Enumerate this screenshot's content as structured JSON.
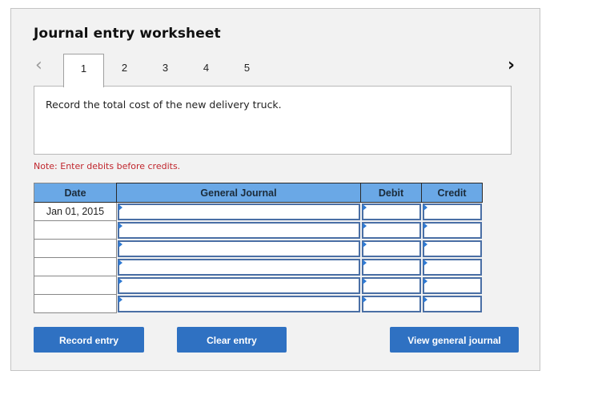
{
  "worksheet": {
    "title": "Journal entry worksheet",
    "nav": {
      "prev_icon": "chevron-left-icon",
      "next_icon": "chevron-right-icon"
    },
    "tabs": [
      {
        "label": "1",
        "active": true
      },
      {
        "label": "2",
        "active": false
      },
      {
        "label": "3",
        "active": false
      },
      {
        "label": "4",
        "active": false
      },
      {
        "label": "5",
        "active": false
      }
    ],
    "description": "Record the total cost of the new delivery truck.",
    "note": "Note: Enter debits before credits."
  },
  "journal": {
    "headers": {
      "date": "Date",
      "general_journal": "General Journal",
      "debit": "Debit",
      "credit": "Credit"
    },
    "rows": [
      {
        "date": "Jan 01, 2015",
        "account": "",
        "debit": "",
        "credit": ""
      },
      {
        "date": "",
        "account": "",
        "debit": "",
        "credit": ""
      },
      {
        "date": "",
        "account": "",
        "debit": "",
        "credit": ""
      },
      {
        "date": "",
        "account": "",
        "debit": "",
        "credit": ""
      },
      {
        "date": "",
        "account": "",
        "debit": "",
        "credit": ""
      },
      {
        "date": "",
        "account": "",
        "debit": "",
        "credit": ""
      }
    ]
  },
  "buttons": {
    "record": "Record entry",
    "clear": "Clear entry",
    "view": "View general journal"
  },
  "colors": {
    "header_bg": "#6aa8e6",
    "button_bg": "#2f71c2",
    "note_text": "#c0262d",
    "input_border": "#4a6fa5"
  }
}
